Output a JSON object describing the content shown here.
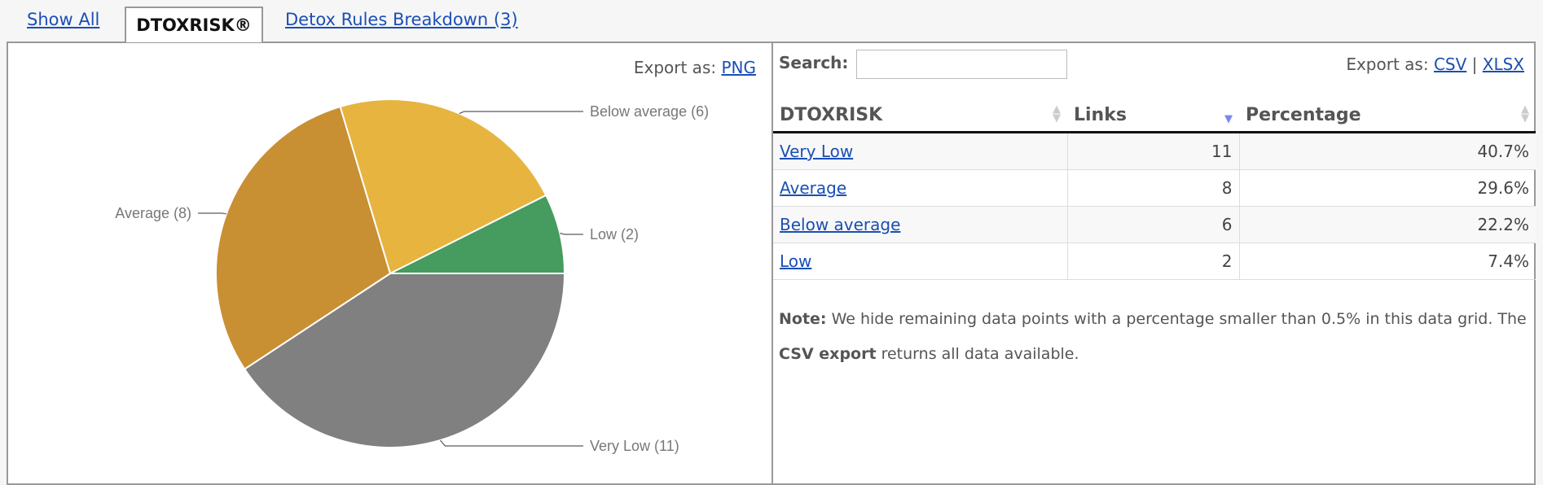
{
  "tabs": [
    {
      "label": "Show All",
      "active": false
    },
    {
      "label": "DTOXRISK®",
      "active": true
    },
    {
      "label": "Detox Rules Breakdown (3)",
      "active": false
    }
  ],
  "chart_panel": {
    "export_label": "Export as:",
    "export_png": "PNG"
  },
  "chart_data": {
    "type": "pie",
    "slices": [
      {
        "label": "Very Low (11)",
        "name": "Very Low",
        "value": 11,
        "color": "#808080"
      },
      {
        "label": "Average (8)",
        "name": "Average",
        "value": 8,
        "color": "#c88f33"
      },
      {
        "label": "Below average (6)",
        "name": "Below average",
        "value": 6,
        "color": "#e6b43f"
      },
      {
        "label": "Low (2)",
        "name": "Low",
        "value": 2,
        "color": "#459c5e"
      }
    ]
  },
  "grid": {
    "search_label": "Search:",
    "search_value": "",
    "export_label": "Export as:",
    "export_csv": "CSV",
    "separator": "|",
    "export_xlsx": "XLSX",
    "columns": [
      "DTOXRISK",
      "Links",
      "Percentage"
    ],
    "sorted_column": "Links",
    "sort_direction": "descending",
    "rows": [
      {
        "name": "Very Low",
        "links": "11",
        "percentage": "40.7%"
      },
      {
        "name": "Average",
        "links": "8",
        "percentage": "29.6%"
      },
      {
        "name": "Below average",
        "links": "6",
        "percentage": "22.2%"
      },
      {
        "name": "Low",
        "links": "2",
        "percentage": "7.4%"
      }
    ],
    "note_bold": "Note:",
    "note_text1": " We hide remaining data points with a percentage smaller than 0.5% in this data grid. The ",
    "note_bold2": "CSV export",
    "note_text2": " returns all data available."
  }
}
